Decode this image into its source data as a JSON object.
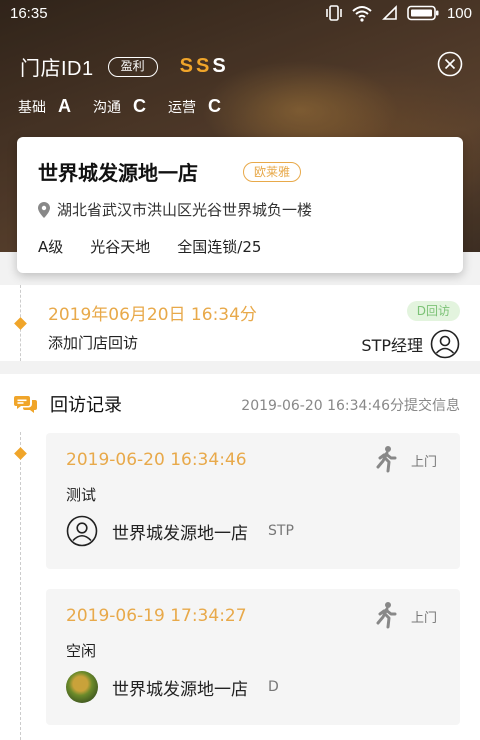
{
  "status_bar": {
    "time": "16:35",
    "battery": "100"
  },
  "store": {
    "id_label": "门店ID1",
    "profit_tag": "盈利",
    "grade": {
      "g1": "S",
      "g2": "S",
      "g3": "S"
    },
    "levels": [
      {
        "label": "基础",
        "value": "A"
      },
      {
        "label": "沟通",
        "value": "C"
      },
      {
        "label": "运营",
        "value": "C"
      }
    ],
    "name": "世界城发源地一店",
    "brand": "欧莱雅",
    "address": "湖北省武汉市洪山区光谷世界城负一楼",
    "tags": [
      "A级",
      "光谷天地",
      "全国连锁/25"
    ]
  },
  "visit": {
    "date": "2019年06月20日 16:34分",
    "action": "添加门店回访",
    "badge": "D回访",
    "role": "STP经理"
  },
  "records": {
    "title": "回访记录",
    "submitted": "2019-06-20 16:34:46分提交信息",
    "entries": [
      {
        "time": "2019-06-20 16:34:46",
        "type": "上门",
        "note": "测试",
        "store": "世界城发源地一店",
        "role": "STP"
      },
      {
        "time": "2019-06-19 17:34:27",
        "type": "上门",
        "note": "空闲",
        "store": "世界城发源地一店",
        "role": "D"
      }
    ]
  },
  "colors": {
    "accent": "#e8a94a",
    "badge_bg": "#e3f4de",
    "badge_text": "#7cc276"
  }
}
